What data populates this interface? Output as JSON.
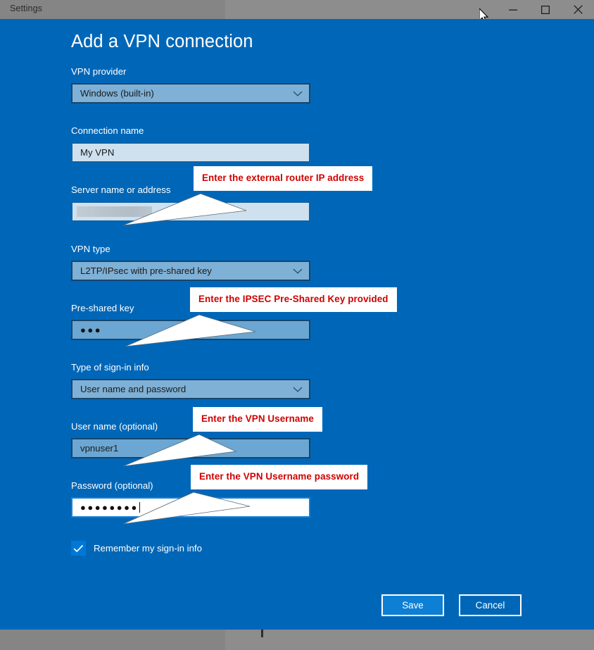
{
  "window": {
    "title": "Settings",
    "minimize_icon": "minimize-icon",
    "maximize_icon": "maximize-icon",
    "close_icon": "close-icon",
    "cursor_icon": "mouse-pointer-icon"
  },
  "page": {
    "title": "Add a VPN connection",
    "background_color": "#0067b8"
  },
  "fields": {
    "vpn_provider": {
      "label": "VPN provider",
      "value": "Windows (built-in)",
      "type": "combobox",
      "icon": "chevron-down-icon"
    },
    "connection_name": {
      "label": "Connection name",
      "value": "My VPN",
      "type": "textbox"
    },
    "server_name": {
      "label": "Server name or address",
      "value": "",
      "type": "textbox",
      "redacted": true
    },
    "vpn_type": {
      "label": "VPN type",
      "value": "L2TP/IPsec with pre-shared key",
      "type": "combobox",
      "icon": "chevron-down-icon"
    },
    "pre_shared_key": {
      "label": "Pre-shared key",
      "value": "●●●",
      "type": "password"
    },
    "sign_in_type": {
      "label": "Type of sign-in info",
      "value": "User name and password",
      "type": "combobox",
      "icon": "chevron-down-icon"
    },
    "user_name": {
      "label": "User name (optional)",
      "value": "vpnuser1",
      "type": "textbox"
    },
    "password": {
      "label": "Password (optional)",
      "value": "●●●●●●●●",
      "type": "password",
      "focused": true
    }
  },
  "checkbox": {
    "label": "Remember my sign-in info",
    "checked": true,
    "icon": "checkmark-icon",
    "color": "#0078d7"
  },
  "buttons": {
    "save": "Save",
    "cancel": "Cancel"
  },
  "callouts": {
    "server": "Enter the external router IP address",
    "psk": "Enter the IPSEC Pre-Shared Key provided",
    "username": "Enter the VPN Username",
    "password": "Enter the VPN Username password",
    "text_color": "#d00000"
  }
}
